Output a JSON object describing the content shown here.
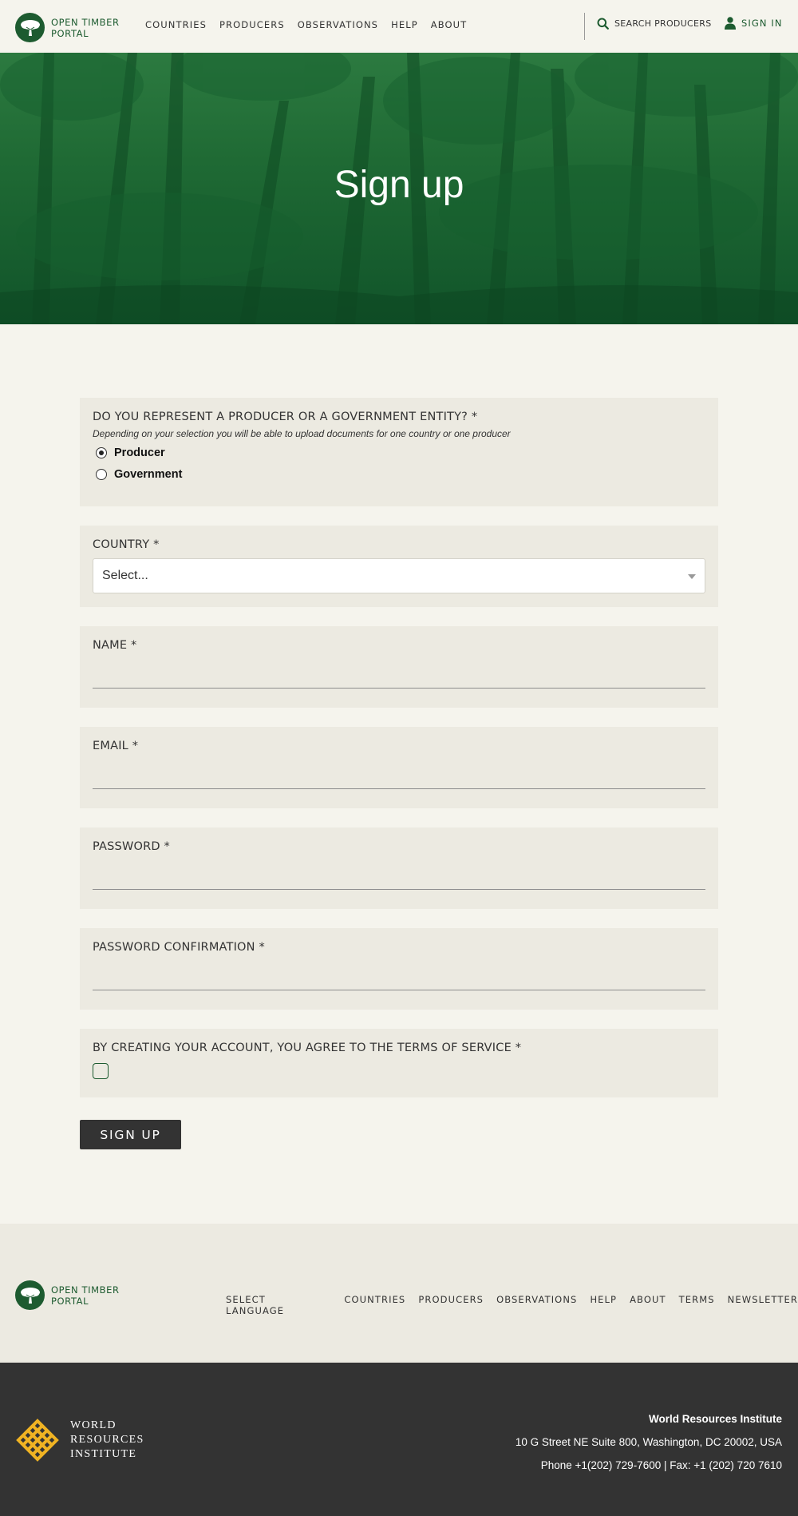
{
  "header": {
    "logo_line1": "OPEN TIMBER",
    "logo_line2": "PORTAL",
    "nav": [
      "COUNTRIES",
      "PRODUCERS",
      "OBSERVATIONS",
      "HELP",
      "ABOUT"
    ],
    "search_label": "SEARCH PRODUCERS",
    "signin_label": "SIGN IN"
  },
  "hero": {
    "title": "Sign up"
  },
  "form": {
    "entity": {
      "label": "DO YOU REPRESENT A PRODUCER OR A GOVERNMENT ENTITY? *",
      "help": "Depending on your selection you will be able to upload documents for one country or one producer",
      "options": [
        "Producer",
        "Government"
      ],
      "selected": "Producer"
    },
    "country": {
      "label": "COUNTRY *",
      "value": "Select..."
    },
    "name": {
      "label": "NAME *",
      "value": ""
    },
    "email": {
      "label": "EMAIL *",
      "value": ""
    },
    "password": {
      "label": "PASSWORD *",
      "value": ""
    },
    "password_confirmation": {
      "label": "PASSWORD CONFIRMATION *",
      "value": ""
    },
    "terms": {
      "label": "BY CREATING YOUR ACCOUNT, YOU AGREE TO THE TERMS OF SERVICE *",
      "checked": false
    },
    "submit_label": "SIGN UP"
  },
  "footer": {
    "logo_line1": "OPEN TIMBER",
    "logo_line2": "PORTAL",
    "language_label": "SELECT LANGUAGE",
    "nav": [
      "COUNTRIES",
      "PRODUCERS",
      "OBSERVATIONS",
      "HELP",
      "ABOUT",
      "TERMS",
      "NEWSLETTER"
    ]
  },
  "bottom": {
    "wri_line1": "WORLD",
    "wri_line2": "RESOURCES",
    "wri_line3": "INSTITUTE",
    "org_name": "World Resources Institute",
    "address": "10 G Street NE Suite 800, Washington, DC 20002, USA",
    "phone": "Phone +1(202) 729-7600",
    "separator": "|",
    "fax": "Fax: +1 (202) 720 7610"
  },
  "colors": {
    "brand_green": "#1d5b30",
    "wri_gold": "#f0b323",
    "dark": "#333333"
  },
  "icons": [
    "tree-icon",
    "search-icon",
    "user-icon",
    "caret-down-icon",
    "wri-knot-icon"
  ]
}
